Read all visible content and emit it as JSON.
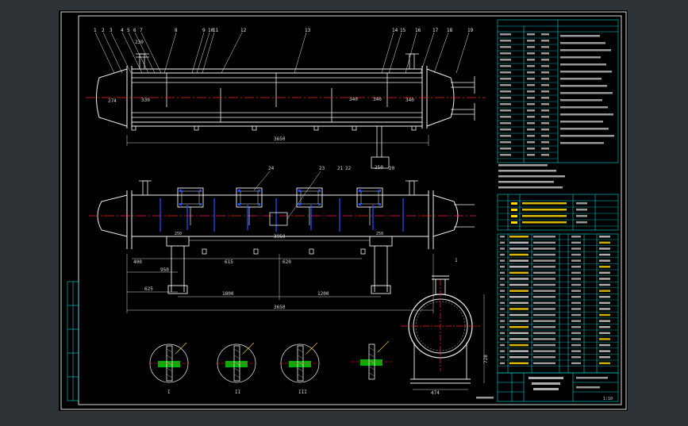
{
  "colors": {
    "frame_bg": "#2e3338",
    "sheet_bg": "#000000",
    "border": "#d8d8d8",
    "table_line": "#00d8d8",
    "geometry": "#f2f2f2",
    "center_line": "#ff2020",
    "dimension": "#d8d8d8",
    "leader": "#e8e8e8",
    "baffle": "#1a4dff",
    "detail_fill": "#00b000",
    "highlight": "#ffd800",
    "weld_hatch": "#c8c8c8"
  },
  "icons": {
    "support_saddle": "saddle-support-icon",
    "nozzle": "nozzle-icon",
    "detail_section": "weld-detail-icon"
  },
  "top_view": {
    "part_numbers": [
      "1",
      "2",
      "3",
      "4",
      "5",
      "6",
      "7",
      "8",
      "9",
      "10",
      "11",
      "12",
      "13",
      "14",
      "15",
      "16",
      "17",
      "18",
      "19"
    ],
    "dims": {
      "overall": "3650",
      "left_head": "330",
      "mid_a": "340",
      "mid_b": "340",
      "inlet_left": "230",
      "left_offset": "274",
      "right_head": "340",
      "support_base": "250",
      "support_labels": [
        "21",
        "22",
        "20"
      ]
    }
  },
  "front_view": {
    "labels": {
      "a": "3950",
      "b": "400",
      "c": "615",
      "d": "620",
      "e": "950",
      "f": "625",
      "g": "1800",
      "h": "1200",
      "overall": "3650",
      "support_left": "250",
      "support_right": "250",
      "tag_1": "24",
      "tag_2": "23",
      "tag_3": "1"
    }
  },
  "side_view": {
    "dims": {
      "width": "474",
      "height": "728"
    }
  },
  "details": {
    "labels": [
      "I",
      "II",
      "III",
      ""
    ]
  },
  "tables": {
    "title_block_lines": [
      "",
      ""
    ],
    "notes_header": "",
    "scale_text": "1:10",
    "drawing_no": "",
    "bottom_caption": ""
  }
}
